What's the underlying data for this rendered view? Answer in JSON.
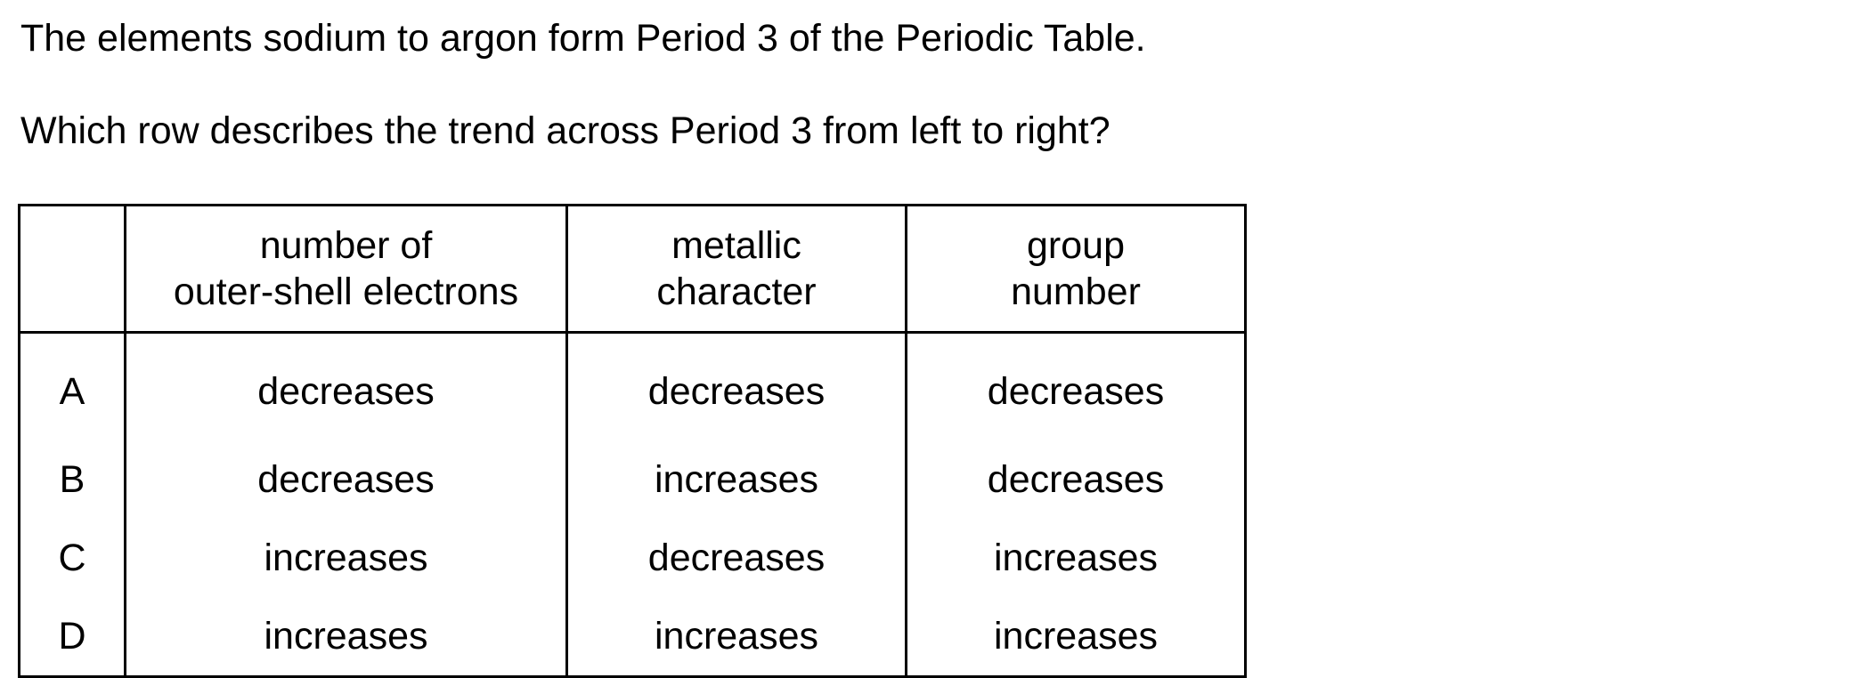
{
  "intro": "The elements sodium to argon form Period 3 of the Periodic Table.",
  "question": "Which row describes the trend across Period 3 from left to right?",
  "table": {
    "headers": [
      {
        "line1": "number of",
        "line2": "outer-shell electrons"
      },
      {
        "line1": "metallic",
        "line2": "character"
      },
      {
        "line1": "group",
        "line2": "number"
      }
    ],
    "rows": [
      {
        "key": "A",
        "cells": [
          "decreases",
          "decreases",
          "decreases"
        ]
      },
      {
        "key": "B",
        "cells": [
          "decreases",
          "increases",
          "decreases"
        ]
      },
      {
        "key": "C",
        "cells": [
          "increases",
          "decreases",
          "increases"
        ]
      },
      {
        "key": "D",
        "cells": [
          "increases",
          "increases",
          "increases"
        ]
      }
    ]
  }
}
